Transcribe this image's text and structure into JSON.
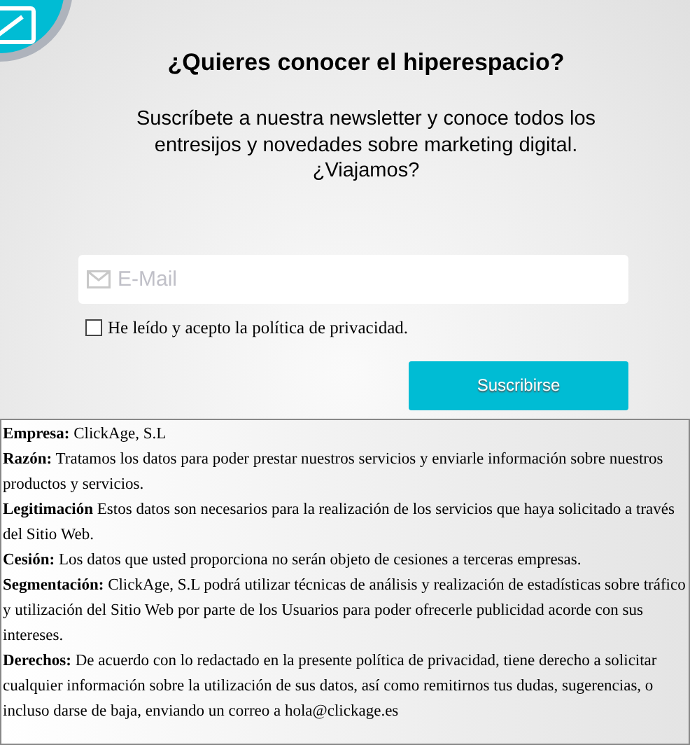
{
  "heading": "¿Quieres conocer el hiperespacio?",
  "intro": "Suscríbete a nuestra newsletter y conoce todos los entresijos y novedades sobre marketing digital. ¿Viajamos?",
  "email": {
    "placeholder": "E-Mail"
  },
  "consent": {
    "label": "He leído y acepto la política de privacidad.",
    "checked": false
  },
  "submit": "Suscribirse",
  "legal": [
    "**Empresa:** ClickAge, S.L",
    "**Razón:** Tratamos los datos para poder prestar nuestros servicios y enviarle información sobre nuestros productos y servicios.",
    "**Legitimación** Estos datos son necesarios para la realización de los servicios que haya solicitado a través del Sitio Web.",
    "**Cesión:** Los datos que usted proporciona no serán objeto de cesiones a terceras empresas.",
    "**Segmentación:** ClickAge, S.L podrá utilizar técnicas de análisis y realización de estadísticas sobre tráfico y utilización del Sitio Web por parte de los Usuarios para poder ofrecerle publicidad acorde con sus intereses.",
    "**Derechos:** De acuerdo con lo redactado en la presente política de privacidad, tiene derecho a solicitar cualquier información sobre la utilización de sus datos, así como remitirnos tus dudas, sugerencias, o incluso darse de baja, enviando un correo a hola@clickage.es"
  ]
}
